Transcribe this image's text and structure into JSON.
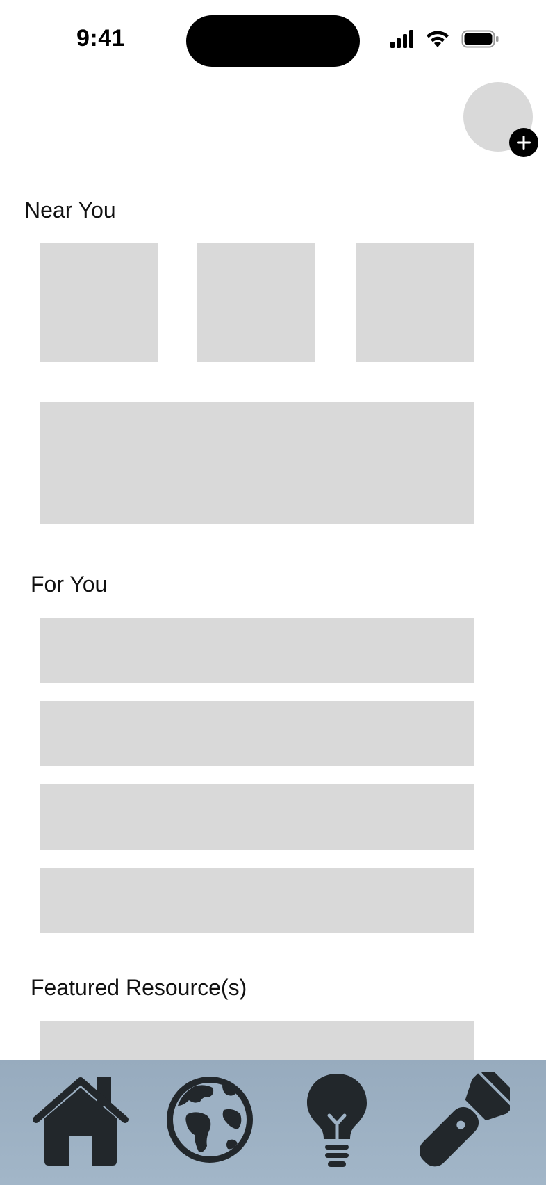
{
  "status_bar": {
    "time": "9:41",
    "icons": [
      "cellular-signal-icon",
      "wifi-icon",
      "battery-icon"
    ]
  },
  "header": {
    "avatar": "profile-avatar",
    "add_icon": "plus-icon"
  },
  "sections": {
    "near_you": {
      "title": "Near You"
    },
    "for_you": {
      "title": "For You"
    },
    "featured": {
      "title": "Featured Resource(s)"
    }
  },
  "tab_bar": {
    "items": [
      {
        "icon": "home-icon"
      },
      {
        "icon": "globe-icon"
      },
      {
        "icon": "lightbulb-icon"
      },
      {
        "icon": "flashlight-icon"
      }
    ]
  },
  "colors": {
    "placeholder": "#d9d9d9",
    "tab_bar": "#9db1c4",
    "icon": "#22272b"
  }
}
